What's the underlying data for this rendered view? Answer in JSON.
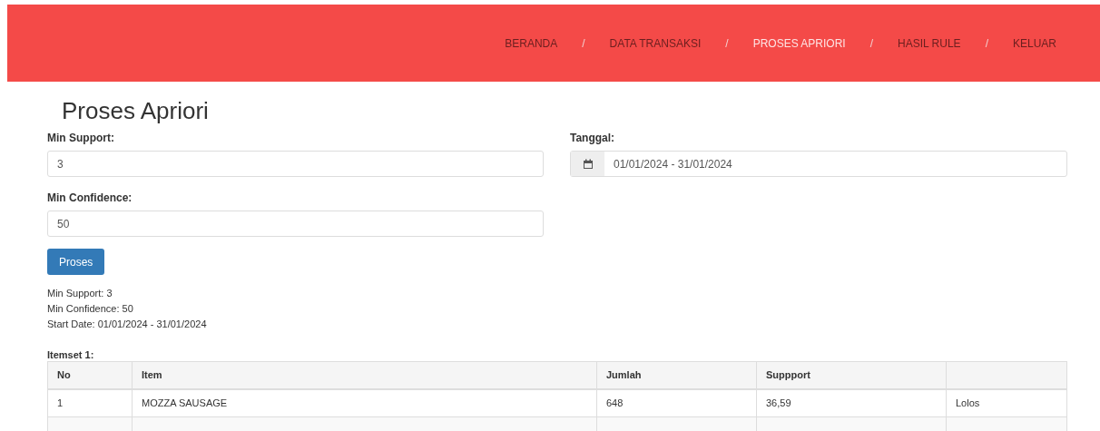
{
  "nav": {
    "items": [
      {
        "label": "BERANDA",
        "selected": false
      },
      {
        "label": "DATA TRANSAKSI",
        "selected": false
      },
      {
        "label": "PROSES APRIORI",
        "selected": true
      },
      {
        "label": "HASIL RULE",
        "selected": false
      },
      {
        "label": "KELUAR",
        "selected": false
      }
    ],
    "separator": "/"
  },
  "title": "Proses Apriori",
  "form": {
    "min_support": {
      "label": "Min Support:",
      "value": "3"
    },
    "date": {
      "label": "Tanggal:",
      "value": "01/01/2024 - 31/01/2024"
    },
    "min_confidence": {
      "label": "Min Confidence:",
      "value": "50"
    },
    "button": "Proses"
  },
  "summary": [
    "Min Support: 3",
    "Min Confidence: 50",
    "Start Date: 01/01/2024 - 31/01/2024"
  ],
  "itemset": {
    "label": "Itemset 1:",
    "columns": [
      "No",
      "Item",
      "Jumlah",
      "Suppport",
      ""
    ],
    "rows": [
      [
        "1",
        "MOZZA SAUSAGE",
        "648",
        "36,59",
        "Lolos"
      ]
    ]
  }
}
